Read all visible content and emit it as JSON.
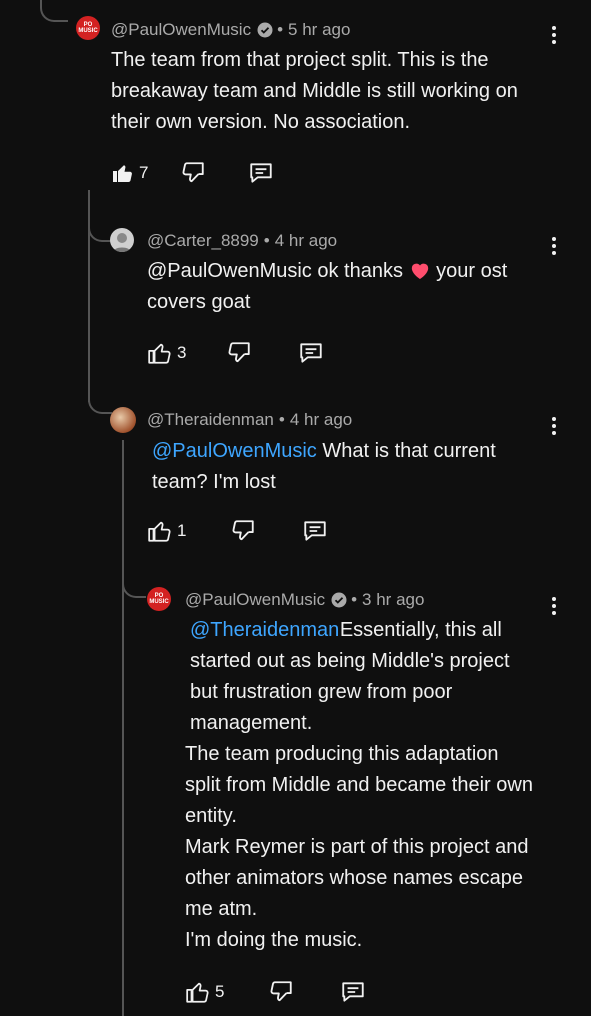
{
  "comments": [
    {
      "author": "@PaulOwenMusic",
      "time": "5 hr ago",
      "text": "The team from that project split. This is the breakaway team and Middle is still working on their own version. No association.",
      "likes": "7",
      "avatar_text": "PO MUSIC",
      "verified": true
    },
    {
      "author": "@Carter_8899",
      "time": "4 hr ago",
      "mention": "@PaulOwenMusic",
      "text": "ok thanks",
      "emoji": "heart",
      "text2": "your ost covers goat",
      "likes": "3"
    },
    {
      "author": "@Theraidenman",
      "time": "4 hr ago",
      "mention": "@PaulOwenMusic",
      "text": "What is that current team? I'm lost",
      "likes": "1"
    },
    {
      "author": "@PaulOwenMusic",
      "time": "3 hr ago",
      "mention": "@Theraidenman",
      "text": "Essentially, this all started out as being Middle's project but frustration grew from poor management.",
      "text2": "The team producing this adaptation split from Middle and became their own entity.",
      "text3": "Mark Reymer is part of this project and other animators whose names escape me atm.",
      "text4": "I'm doing the music.",
      "likes": "5",
      "avatar_text": "PO MUSIC",
      "verified": true
    }
  ],
  "separator": "•",
  "colors": {
    "mention": "#3ea6ff",
    "background": "#0f0f0f",
    "heart": "#ff4d6d"
  }
}
